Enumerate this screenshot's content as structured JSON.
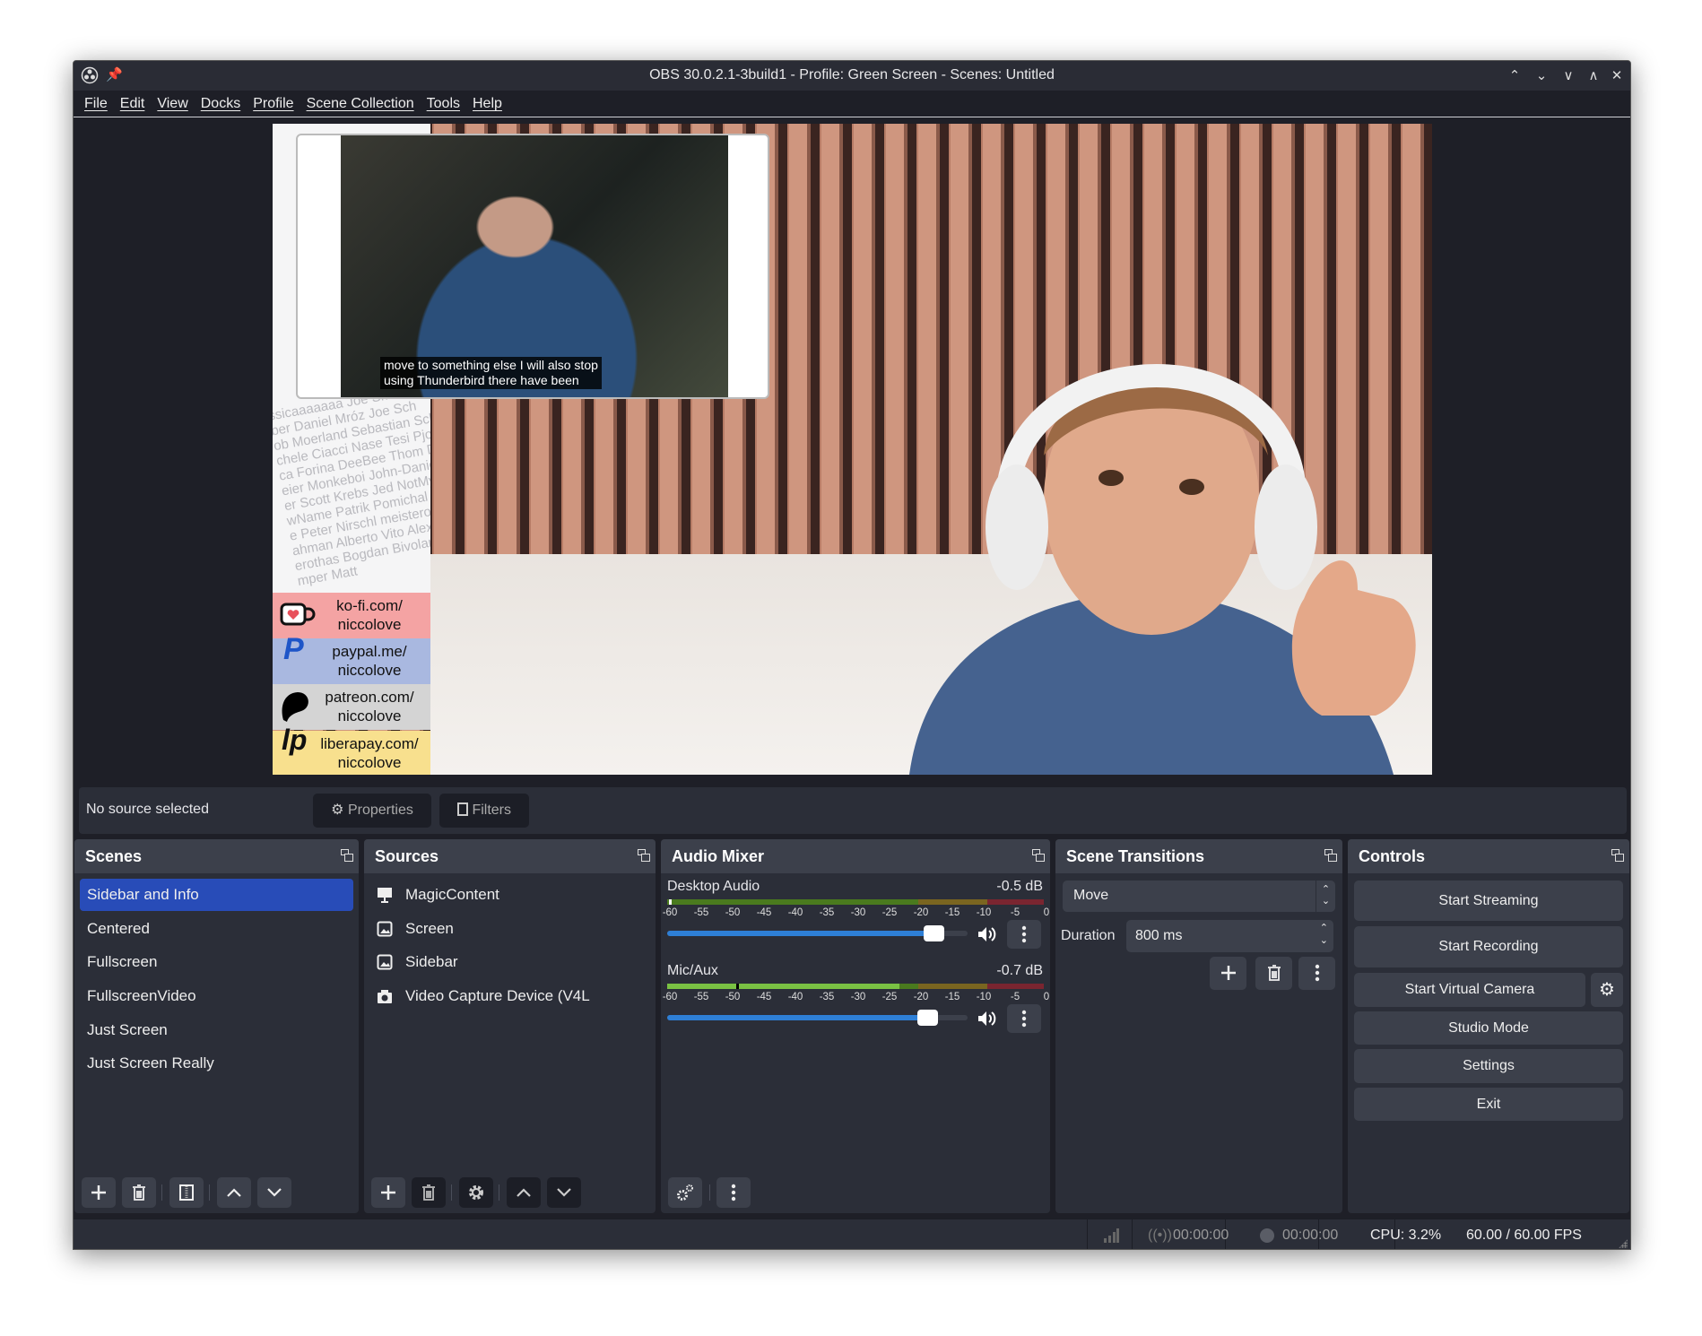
{
  "window": {
    "title": "OBS 30.0.2.1-3build1 - Profile: Green Screen - Scenes: Untitled"
  },
  "menu": [
    "File",
    "Edit",
    "View",
    "Docks",
    "Profile",
    "Scene Collection",
    "Tools",
    "Help"
  ],
  "preview": {
    "supporter_names": [
      "ssicaaaaaaa Joe Sm",
      "ber Daniel Mróz Joe Sch",
      "ob Moerland Sebastian Schn",
      "chele Ciacci Nase Tesi Pjol D",
      "ca Forina DeeBee Thom Diet",
      "eier Monkeboi John-Daniel T",
      "er Scott Krebs Jed NotMyN",
      "wName Patrik Pomichal NoN",
      "e Peter Nirschl meisterolsen",
      "ahman Alberto Vito Alexand",
      "erothas Bogdan Bivolaru",
      "mper Matt"
    ],
    "donations": [
      {
        "line1": "ko-fi.com/",
        "line2": "niccolove",
        "color": "#f4a3a3"
      },
      {
        "line1": "paypal.me/",
        "line2": "niccolove",
        "color": "#a9b8e0"
      },
      {
        "line1": "patreon.com/",
        "line2": "niccolove",
        "color": "#d4d4d4"
      },
      {
        "line1": "liberapay.com/",
        "line2": "niccolove",
        "color": "#f8e08e"
      }
    ],
    "caption_line1": "move to something else I will also stop",
    "caption_line2": "using Thunderbird there have been"
  },
  "source_bar": {
    "status": "No source selected",
    "properties": "Properties",
    "filters": "Filters"
  },
  "scenes": {
    "title": "Scenes",
    "items": [
      "Sidebar and Info",
      "Centered",
      "Fullscreen",
      "FullscreenVideo",
      "Just Screen",
      "Just Screen Really"
    ],
    "selected": "Sidebar and Info"
  },
  "sources": {
    "title": "Sources",
    "items": [
      {
        "name": "MagicContent",
        "icon": "slideshow-icon",
        "visible": true,
        "locked": false
      },
      {
        "name": "Screen",
        "icon": "image-icon",
        "visible": true,
        "locked": false
      },
      {
        "name": "Sidebar",
        "icon": "image-icon",
        "visible": true,
        "locked": false
      },
      {
        "name": "Video Capture Device (V4L",
        "icon": "camera-icon",
        "visible": true,
        "locked": false
      }
    ]
  },
  "audio": {
    "title": "Audio Mixer",
    "ticks": [
      "-60",
      "-55",
      "-50",
      "-45",
      "-40",
      "-35",
      "-30",
      "-25",
      "-20",
      "-15",
      "-10",
      "-5",
      "0"
    ],
    "channels": [
      {
        "name": "Desktop Audio",
        "db": "-0.5 dB",
        "level_db": -60,
        "peak_db": -60,
        "fader": 0.93
      },
      {
        "name": "Mic/Aux",
        "db": "-0.7 dB",
        "level_db": -23,
        "peak_db": -49,
        "fader": 0.91
      }
    ],
    "colors": {
      "green": "#7ac143",
      "green_dim": "#4a7a1e",
      "yellow_dim": "#7a6520",
      "red_dim": "#7a2530",
      "fader": "#2e7fd6"
    }
  },
  "transitions": {
    "title": "Scene Transitions",
    "selected": "Move",
    "duration_label": "Duration",
    "duration": "800 ms"
  },
  "controls": {
    "title": "Controls",
    "start_streaming": "Start Streaming",
    "start_recording": "Start Recording",
    "start_virtual_camera": "Start Virtual Camera",
    "studio_mode": "Studio Mode",
    "settings": "Settings",
    "exit": "Exit"
  },
  "status": {
    "stream_time": "00:00:00",
    "record_time": "00:00:00",
    "cpu": "CPU: 3.2%",
    "fps": "60.00 / 60.00 FPS"
  },
  "colors": {
    "selected": "#284cb8",
    "panel": "#2b2e38",
    "header": "#3c404b"
  }
}
